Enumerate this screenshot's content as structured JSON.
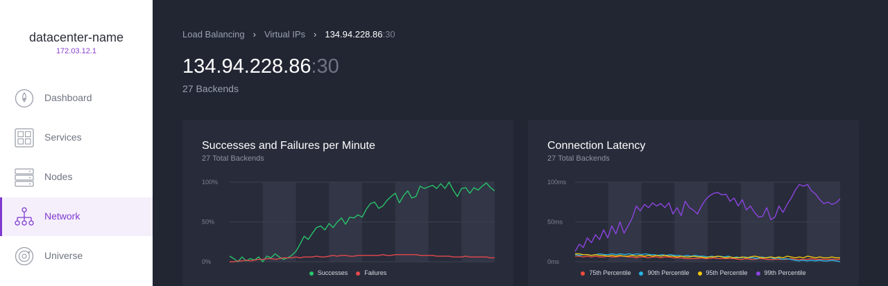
{
  "sidebar": {
    "datacenter_name": "datacenter-name",
    "datacenter_ip": "172.03.12.1",
    "items": [
      {
        "label": "Dashboard",
        "icon": "dashboard-icon",
        "active": false
      },
      {
        "label": "Services",
        "icon": "services-icon",
        "active": false
      },
      {
        "label": "Nodes",
        "icon": "nodes-icon",
        "active": false
      },
      {
        "label": "Network",
        "icon": "network-icon",
        "active": true
      },
      {
        "label": "Universe",
        "icon": "universe-icon",
        "active": false
      }
    ]
  },
  "breadcrumb": {
    "items": [
      "Load Balancing",
      "Virtual IPs"
    ],
    "current_ip": "134.94.228.86",
    "current_port": ":30"
  },
  "header": {
    "title_ip": "134.94.228.86",
    "title_port": ":30",
    "subtitle": "27 Backends"
  },
  "colors": {
    "accent": "#7e3ad0",
    "successes": "#27c46b",
    "failures": "#e5484d",
    "p75": "#ef4d3c",
    "p90": "#27b3e6",
    "p95": "#f1c40f",
    "p99": "#8c44e0"
  },
  "chart_data": [
    {
      "type": "line",
      "title": "Successes and Failures per Minute",
      "subtitle": "27 Total Backends",
      "ylim": [
        0,
        100
      ],
      "y_ticks": [
        "100%",
        "50%",
        "0%"
      ],
      "y_tick_values": [
        100,
        50,
        0
      ],
      "grid": true,
      "legend_position": "bottom",
      "series": [
        {
          "name": "Successes",
          "color": "#27c46b",
          "values": [
            7,
            4,
            0,
            6,
            1,
            4,
            2,
            6,
            0,
            7,
            5,
            10,
            6,
            3,
            5,
            8,
            13,
            22,
            32,
            28,
            36,
            43,
            45,
            40,
            48,
            43,
            50,
            55,
            47,
            56,
            55,
            59,
            56,
            66,
            73,
            75,
            67,
            70,
            77,
            82,
            86,
            74,
            83,
            89,
            80,
            82,
            95,
            92,
            94,
            96,
            92,
            98,
            92,
            100,
            90,
            82,
            92,
            93,
            86,
            93,
            90,
            95,
            99,
            93,
            89
          ]
        },
        {
          "name": "Failures",
          "color": "#e5484d",
          "values": [
            0,
            0,
            1,
            1,
            2,
            1,
            2,
            3,
            3,
            4,
            4,
            3,
            4,
            5,
            5,
            5,
            6,
            5,
            6,
            6,
            6,
            7,
            6,
            6,
            7,
            8,
            7,
            8,
            8,
            7,
            7,
            8,
            8,
            8,
            8,
            8,
            8,
            9,
            8,
            8,
            9,
            9,
            9,
            9,
            9,
            9,
            8,
            8,
            8,
            8,
            7,
            7,
            7,
            7,
            6,
            6,
            6,
            7,
            6,
            6,
            6,
            6,
            6,
            5,
            5
          ]
        }
      ]
    },
    {
      "type": "line",
      "title": "Connection Latency",
      "subtitle": "27 Total Backends",
      "ylim": [
        0,
        100
      ],
      "y_ticks": [
        "100ms",
        "50ms",
        "0ms"
      ],
      "y_tick_values": [
        100,
        50,
        0
      ],
      "grid": true,
      "legend_position": "bottom",
      "series": [
        {
          "name": "75th Percentile",
          "color": "#ef4d3c",
          "values": [
            7,
            7,
            6,
            7,
            6,
            7,
            6,
            6,
            7,
            6,
            6,
            7,
            7,
            6,
            6,
            5,
            6,
            6,
            5,
            6,
            6,
            5,
            6,
            6,
            5,
            5,
            5,
            4,
            4,
            4,
            4,
            5,
            4,
            4,
            5,
            4,
            4,
            4,
            4,
            4,
            3,
            3,
            4,
            3,
            3,
            4,
            4,
            3,
            3,
            3,
            3,
            3,
            3,
            4,
            3,
            3,
            3,
            3,
            4,
            3,
            3,
            3,
            3,
            3,
            3,
            3
          ]
        },
        {
          "name": "90th Percentile",
          "color": "#27b3e6",
          "values": [
            9,
            8,
            9,
            9,
            8,
            9,
            10,
            9,
            9,
            10,
            9,
            10,
            9,
            10,
            9,
            10,
            9,
            10,
            9,
            9,
            8,
            9,
            8,
            9,
            8,
            8,
            7,
            8,
            7,
            8,
            7,
            7,
            6,
            7,
            6,
            7,
            6,
            7,
            5,
            6,
            5,
            6,
            5,
            5,
            4,
            6,
            5,
            6,
            4,
            5,
            3,
            4,
            3,
            2,
            1,
            2,
            1,
            2,
            1,
            2,
            1,
            1,
            2,
            1,
            0
          ]
        },
        {
          "name": "95th Percentile",
          "color": "#f1c40f",
          "values": [
            10,
            10,
            9,
            9,
            8,
            9,
            8,
            8,
            7,
            8,
            7,
            8,
            7,
            7,
            8,
            7,
            8,
            7,
            8,
            7,
            8,
            7,
            8,
            7,
            7,
            6,
            7,
            6,
            6,
            7,
            6,
            6,
            5,
            6,
            6,
            7,
            6,
            5,
            6,
            5,
            5,
            6,
            5,
            6,
            7,
            6,
            5,
            5,
            6,
            5,
            6,
            5,
            7,
            6,
            5,
            6,
            5,
            7,
            6,
            5,
            6,
            5,
            5,
            6,
            5,
            5
          ]
        },
        {
          "name": "99th Percentile",
          "color": "#8c44e0",
          "values": [
            13,
            22,
            18,
            30,
            24,
            34,
            28,
            40,
            30,
            45,
            35,
            50,
            36,
            45,
            55,
            70,
            64,
            72,
            68,
            74,
            70,
            73,
            68,
            74,
            60,
            68,
            58,
            76,
            68,
            65,
            60,
            70,
            78,
            83,
            86,
            87,
            84,
            85,
            76,
            80,
            70,
            78,
            65,
            70,
            62,
            56,
            57,
            68,
            53,
            56,
            70,
            62,
            72,
            80,
            90,
            97,
            95,
            97,
            89,
            85,
            78,
            73,
            75,
            72,
            74,
            79
          ]
        }
      ]
    }
  ]
}
